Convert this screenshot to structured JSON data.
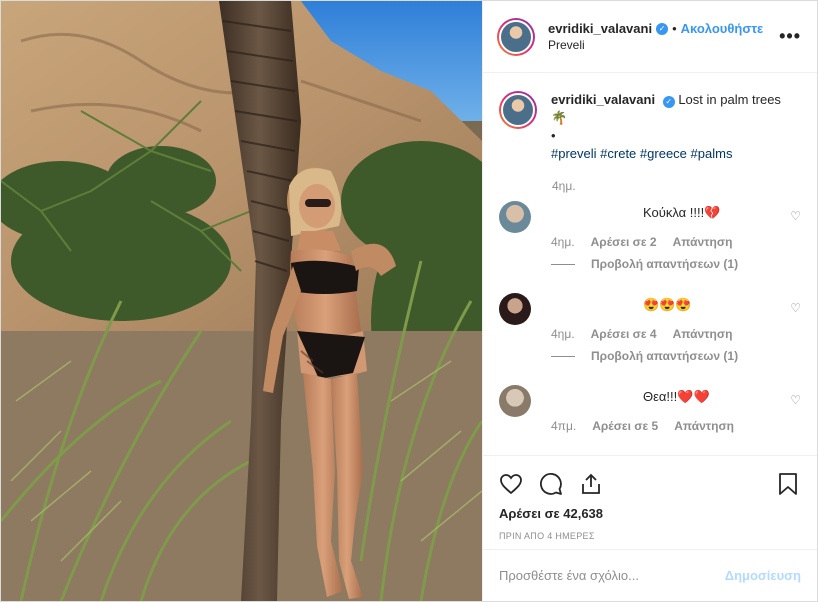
{
  "post": {
    "username": "evridiki_valavani",
    "verified_icon": "verified-badge-icon",
    "follow_label": "Ακολουθήστε",
    "location": "Preveli",
    "more_icon": "more-options-icon"
  },
  "caption": {
    "username": "evridiki_valavani",
    "text": "Lost in palm trees",
    "emoji": "🌴",
    "bullet": "•",
    "hashtags": [
      "#preveli",
      "#crete",
      "#greece",
      "#palms"
    ],
    "time": "4ημ."
  },
  "comments": [
    {
      "username": "",
      "text": "Κούκλα !!!!💔",
      "time": "4ημ.",
      "likes": "Αρέσει σε 2",
      "reply": "Απάντηση",
      "view_replies": "Προβολή απαντήσεων (1)"
    },
    {
      "username": "",
      "text": "😍😍😍",
      "time": "4ημ.",
      "likes": "Αρέσει σε 4",
      "reply": "Απάντηση",
      "view_replies": "Προβολή απαντήσεων (1)"
    },
    {
      "username": "",
      "text": "Θεα!!!❤️❤️",
      "time": "4πμ.",
      "likes": "Αρέσει σε 5",
      "reply": "Απάντηση",
      "view_replies": ""
    }
  ],
  "actions": {
    "like_icon": "heart-icon",
    "comment_icon": "comment-icon",
    "share_icon": "share-icon",
    "save_icon": "bookmark-icon",
    "likes_text": "Αρέσει σε 42,638",
    "date": "ΠΡΙΝ ΑΠΟ 4 ΗΜΕΡΕΣ"
  },
  "add_comment": {
    "placeholder": "Προσθέστε ένα σχόλιο...",
    "post_label": "Δημοσίευση"
  },
  "colors": {
    "accent": "#3897f0",
    "text": "#262626",
    "secondary": "#8e8e8e",
    "post_disabled": "#b3dbff"
  }
}
